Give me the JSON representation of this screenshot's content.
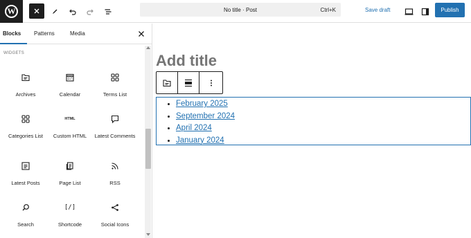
{
  "topbar": {
    "document_title": "No title · Post",
    "shortcut": "Ctrl+K",
    "save_draft_label": "Save draft",
    "publish_label": "Publish",
    "icons": [
      "wordpress-logo",
      "close-icon",
      "pen-icon",
      "undo-icon",
      "redo-icon",
      "document-overview-icon",
      "preview-icon",
      "settings-sidebar-icon"
    ]
  },
  "sidebar": {
    "tabs": [
      {
        "label": "Blocks",
        "active": true
      },
      {
        "label": "Patterns",
        "active": false
      },
      {
        "label": "Media",
        "active": false
      }
    ],
    "section_label": "WIDGETS",
    "blocks": [
      {
        "label": "Archives",
        "icon": "archive-icon"
      },
      {
        "label": "Calendar",
        "icon": "calendar-icon"
      },
      {
        "label": "Terms List",
        "icon": "terms-list-icon"
      },
      {
        "label": "Categories List",
        "icon": "categories-icon"
      },
      {
        "label": "Custom HTML",
        "icon": "html-icon",
        "icon_text": "HTML"
      },
      {
        "label": "Latest Comments",
        "icon": "comment-icon"
      },
      {
        "label": "Latest Posts",
        "icon": "latest-posts-icon"
      },
      {
        "label": "Page List",
        "icon": "page-list-icon"
      },
      {
        "label": "RSS",
        "icon": "rss-icon"
      },
      {
        "label": "Search",
        "icon": "search-icon"
      },
      {
        "label": "Shortcode",
        "icon": "shortcode-icon",
        "icon_text": "[/]"
      },
      {
        "label": "Social Icons",
        "icon": "share-icon"
      }
    ]
  },
  "editor": {
    "title_placeholder": "Add title",
    "toolbar_icons": [
      "archive-icon",
      "align-icon",
      "more-options-icon"
    ],
    "list_items": [
      "February 2025",
      "September 2024",
      "April 2024",
      "January 2024"
    ]
  },
  "colors": {
    "accent": "#2271b1",
    "dark": "#1e1e1e",
    "muted": "#757575"
  }
}
